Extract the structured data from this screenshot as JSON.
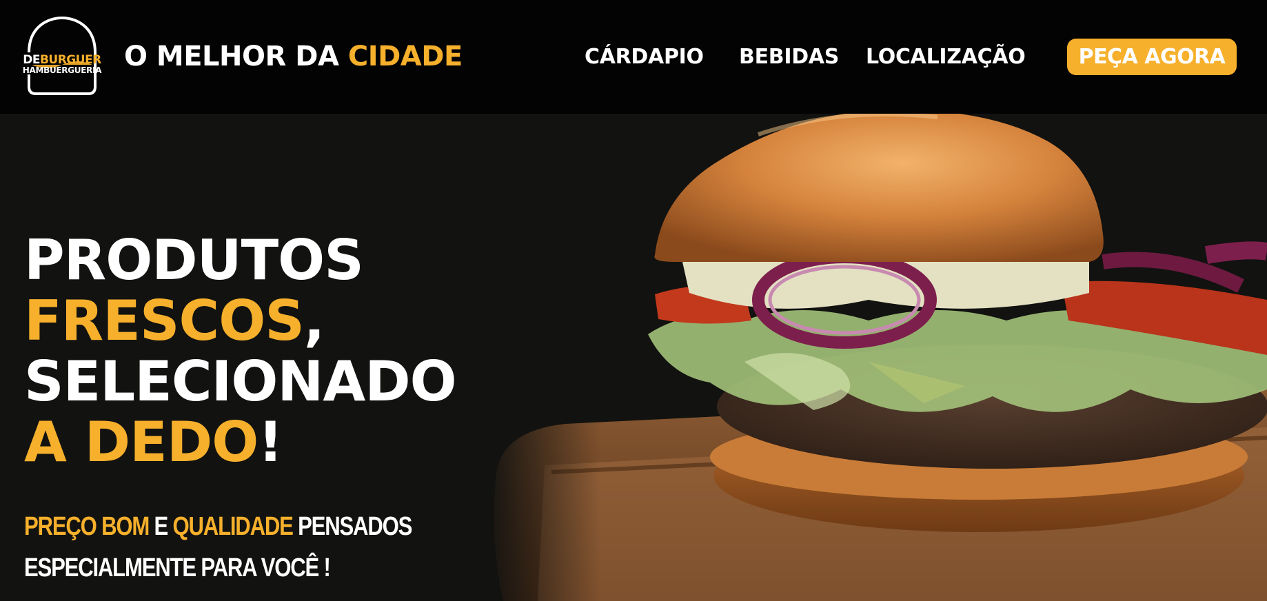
{
  "brand": {
    "logo_line1_part1": "DE",
    "logo_line1_part2": "BURGUER",
    "logo_line2": "HAMBUERGUERIA"
  },
  "header": {
    "tagline_white": "O MELHOR DA ",
    "tagline_yellow": "CIDADE"
  },
  "nav": {
    "items": [
      {
        "label": "CÁRDAPIO"
      },
      {
        "label": "BEBIDAS"
      },
      {
        "label": "LOCALIZAÇÃO"
      }
    ],
    "cta_label": "PEÇA AGORA"
  },
  "hero": {
    "line1": "PRODUTOS",
    "line2_yellow": "FRESCOS",
    "line2_white": ",",
    "line3": "SELECIONADO",
    "line4_yellow": "A DEDO",
    "line4_white": "!",
    "sub_part1_yellow": "PREÇO BOM",
    "sub_part2_white": " E ",
    "sub_part3_yellow": "QUALIDADE",
    "sub_part4_white": " PENSADOS",
    "sub_line2": "ESPECIALMENTE PARA VOCÊ !"
  },
  "colors": {
    "accent": "#f6b02c",
    "header_bg": "#030303",
    "hero_bg": "#121210",
    "text": "#ffffff"
  },
  "icons": [
    "burger-logo-icon",
    "burger-photo"
  ]
}
